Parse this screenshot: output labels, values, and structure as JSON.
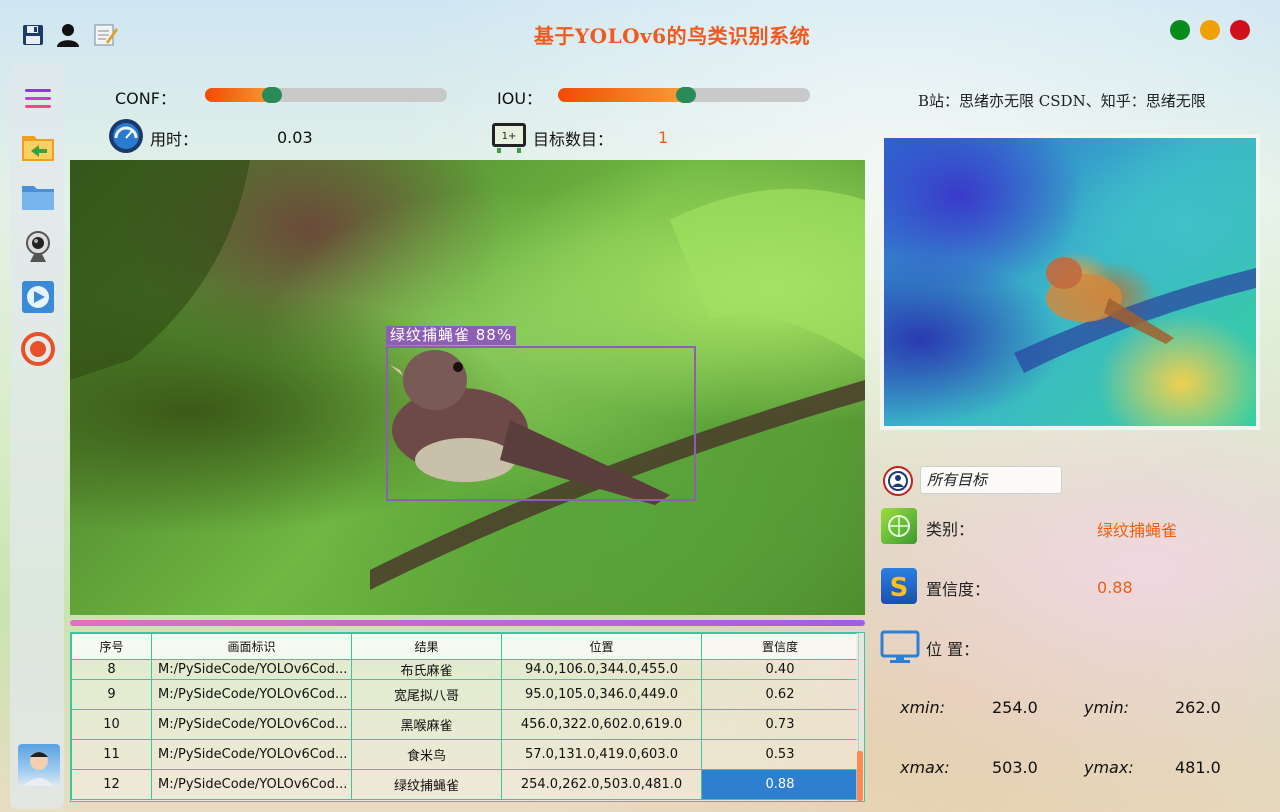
{
  "app": {
    "title": "基于YOLOv6的鸟类识别系统",
    "credit": "B站：思绪亦无限  CSDN、知乎：思绪无限"
  },
  "toolbar": {
    "icons": [
      "save-icon",
      "user-icon",
      "edit-icon"
    ],
    "window_buttons": [
      {
        "name": "maximize",
        "color": "#0a8c1c"
      },
      {
        "name": "minimize",
        "color": "#f0a000"
      },
      {
        "name": "close",
        "color": "#d0101a"
      }
    ]
  },
  "sidebar": {
    "items": [
      "menu-icon",
      "open-folder-import-icon",
      "folder-icon",
      "webcam-icon",
      "video-play-icon",
      "stop-icon",
      "avatar"
    ]
  },
  "controls": {
    "conf_label": "CONF：",
    "conf_value": 0.27,
    "iou_label": "IOU：",
    "iou_value": 0.51,
    "time_label": "用时：",
    "time_value": "0.03",
    "count_label": "目标数目：",
    "count_value": "1"
  },
  "detection": {
    "label": "绿纹捕蝇雀  88%",
    "box_color": "#8c5fb2"
  },
  "table": {
    "headers": [
      "序号",
      "画面标识",
      "结果",
      "位置",
      "置信度"
    ],
    "rows": [
      {
        "id": "8",
        "path": "M:/PySideCode/YOLOv6Cod...",
        "result": "布氏麻雀",
        "position": "94.0,106.0,344.0,455.0",
        "conf": "0.40"
      },
      {
        "id": "9",
        "path": "M:/PySideCode/YOLOv6Cod...",
        "result": "宽尾拟八哥",
        "position": "95.0,105.0,346.0,449.0",
        "conf": "0.62"
      },
      {
        "id": "10",
        "path": "M:/PySideCode/YOLOv6Cod...",
        "result": "黑喉麻雀",
        "position": "456.0,322.0,602.0,619.0",
        "conf": "0.73"
      },
      {
        "id": "11",
        "path": "M:/PySideCode/YOLOv6Cod...",
        "result": "食米鸟",
        "position": "57.0,131.0,419.0,603.0",
        "conf": "0.53"
      },
      {
        "id": "12",
        "path": "M:/PySideCode/YOLOv6Cod...",
        "result": "绿纹捕蝇雀",
        "position": "254.0,262.0,503.0,481.0",
        "conf": "0.88"
      }
    ]
  },
  "details": {
    "target_select": "所有目标",
    "class_label": "类别：",
    "class_value": "绿纹捕蝇雀",
    "conf_label": "置信度：",
    "conf_value": "0.88",
    "position_label": "位 置：",
    "xmin_label": "xmin:",
    "xmin_value": "254.0",
    "ymin_label": "ymin:",
    "ymin_value": "262.0",
    "xmax_label": "xmax:",
    "xmax_value": "503.0",
    "ymax_label": "ymax:",
    "ymax_value": "481.0"
  }
}
